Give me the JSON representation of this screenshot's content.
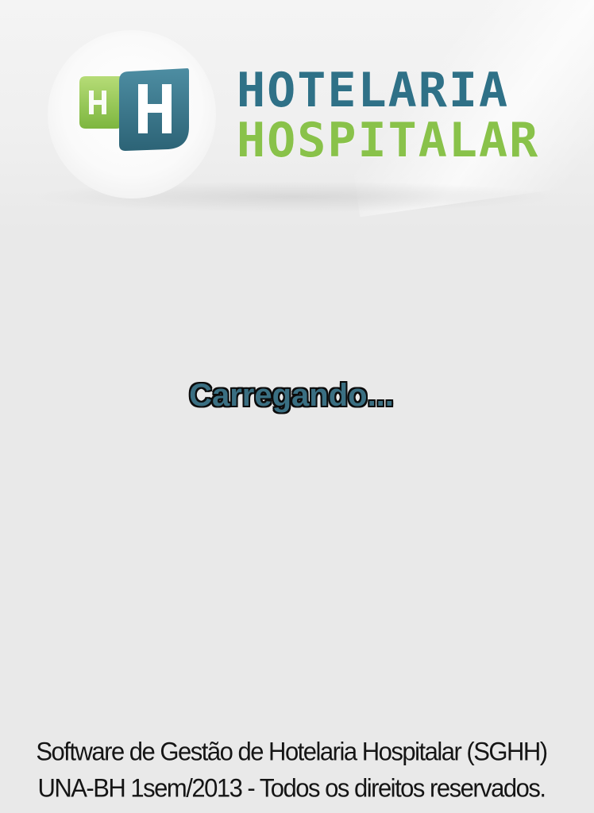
{
  "brand": {
    "logo_mark_letters": "HH",
    "line1": "HOTELARIA",
    "line2": "HOSPITALAR",
    "colors": {
      "blue": "#2f7187",
      "green": "#89c24a"
    }
  },
  "loading": {
    "text": "Carregando..."
  },
  "footer": {
    "line1": "Software de Gestão de Hotelaria Hospitalar (SGHH)",
    "line2": "UNA-BH 1sem/2013 - Todos os direitos reservados."
  }
}
